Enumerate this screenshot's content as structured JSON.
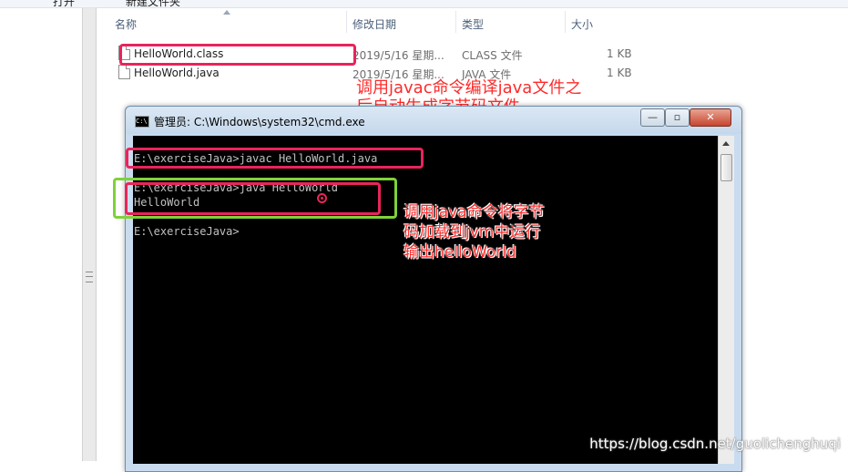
{
  "explorer": {
    "toolbar": [
      "打开",
      "新建文件夹"
    ],
    "columns": {
      "name": "名称",
      "date": "修改日期",
      "type": "类型",
      "size": "大小"
    },
    "files": [
      {
        "name": "HelloWorld.class",
        "date": "2019/5/16 星期...",
        "type": "CLASS 文件",
        "size": "1 KB"
      },
      {
        "name": "HelloWorld.java",
        "date": "2019/5/16 星期...",
        "type": "JAVA 文件",
        "size": "1 KB"
      }
    ]
  },
  "cmd": {
    "title": "管理员: C:\\Windows\\system32\\cmd.exe",
    "buttons": {
      "minimize": "—",
      "maximize": "▫",
      "close": "✕"
    },
    "lines": [
      "E:\\exerciseJava>javac HelloWorld.java",
      "E:\\exerciseJava>java HelloWorld",
      "HelloWorld",
      "E:\\exerciseJava>"
    ]
  },
  "annotations": {
    "compile_note": "调用javac命令编译java文件之后自动生成字节码文件",
    "compile_note_line1": "调用javac命令编译java文件之",
    "compile_note_line2": "后自动生成字节码文件",
    "run_note_line1": "调用java命令将字节",
    "run_note_line2": "码加载到jvm中运行",
    "run_note_line3": "输出helloWorld",
    "colors": {
      "pink": "#e8245b",
      "green": "#7fd23a",
      "text": "#ff2a2a"
    }
  },
  "watermark": "https://blog.csdn.net/guolichenghuqi"
}
